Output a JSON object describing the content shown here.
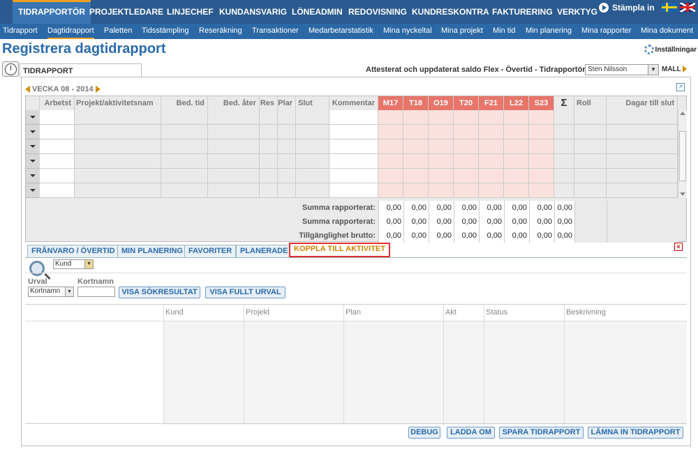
{
  "topnav": {
    "items": [
      "TIDRAPPORTÖR",
      "PROJEKTLEDARE",
      "LINJECHEF",
      "KUNDANSVARIG",
      "LÖNEADMIN",
      "REDOVISNING",
      "KUNDRESKONTRA",
      "FAKTURERING",
      "VERKTYG"
    ],
    "stampla": "Stämpla in"
  },
  "subnav": {
    "items": [
      "Tidrapport",
      "Dagtidrapport",
      "Paletten",
      "Tidsstämpling",
      "Reseräkning",
      "Transaktioner",
      "Medarbetarstatistik",
      "Mina nyckeltal",
      "Mina projekt",
      "Min tid",
      "Min planering",
      "Mina rapporter",
      "Mina dokument"
    ]
  },
  "page": {
    "title": "Registrera dagtidrapport",
    "settings": "Inställningar",
    "tab": "TIDRAPPORT",
    "attest": "Attesterat och uppdaterat saldo Flex - Övertid - Tidrapportör",
    "user": "Sten Nilsson",
    "mall": "MALL"
  },
  "grid": {
    "week": "VECKA 08 - 2014",
    "headers": [
      "Arbetst",
      "Projekt/aktivitetsnam",
      "Bed. tid",
      "Bed. åter",
      "Res",
      "Plar",
      "Slut",
      "Kommentar"
    ],
    "days": [
      "M17",
      "T18",
      "O19",
      "T20",
      "F21",
      "L22",
      "S23"
    ],
    "sigma": "Σ",
    "roll": "Roll",
    "dagar": "Dagar till slut",
    "sums": [
      {
        "label": "Summa rapporterat:",
        "values": [
          "0,00",
          "0,00",
          "0,00",
          "0,00",
          "0,00",
          "0,00",
          "0,00",
          "0,00"
        ]
      },
      {
        "label": "Summa rapporterat:",
        "values": [
          "0,00",
          "0,00",
          "0,00",
          "0,00",
          "0,00",
          "0,00",
          "0,00",
          "0,00"
        ]
      },
      {
        "label": "Tillgänglighet brutto:",
        "values": [
          "0,00",
          "0,00",
          "0,00",
          "0,00",
          "0,00",
          "0,00",
          "0,00",
          "0,00"
        ]
      }
    ]
  },
  "panel": {
    "tabs": [
      "FRÅNVARO / ÖVERTID",
      "MIN PLANERING",
      "FAVORITER",
      "PLANERADE",
      "KOPPLA TILL AKTIVITET"
    ],
    "kund": "Kund",
    "urval_label": "Urval",
    "kortnamn_label": "Kortnamn",
    "urval_value": "Kortnamn",
    "visa_sok": "VISA SÖKRESULTAT",
    "visa_full": "VISA FULLT URVAL",
    "columns": [
      "Kund",
      "Projekt",
      "Plan",
      "Akt",
      "Status",
      "Beskrivning"
    ]
  },
  "footer": {
    "debug": "DEBUG",
    "ladda": "LADDA OM",
    "spara": "SPARA TIDRAPPORT",
    "lamna": "LÄMNA IN TIDRAPPORT"
  }
}
